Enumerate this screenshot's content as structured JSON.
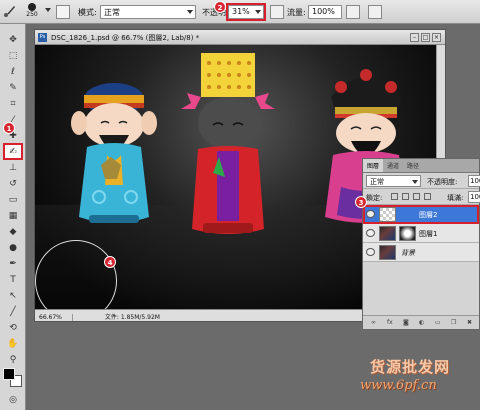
{
  "options_bar": {
    "brush_size": "250",
    "mode_label": "模式:",
    "mode_value": "正常",
    "opacity_label": "不透明度:",
    "opacity_value": "31%",
    "flow_label": "流量:",
    "flow_value": "100%"
  },
  "document": {
    "title": "DSC_1826_1.psd @ 66.7% (图層2, Lab/8) *",
    "zoom": "66.67%",
    "file_info": "文件: 1.85M/5.92M"
  },
  "badges": {
    "b1": "1",
    "b2": "2",
    "b3": "3",
    "b4": "4"
  },
  "layers_panel": {
    "tabs": [
      "图層",
      "通道",
      "路径"
    ],
    "blend_mode": "正常",
    "opacity_label": "不透明度:",
    "opacity_value": "100%",
    "lock_label": "鎖定:",
    "fill_label": "填滿:",
    "fill_value": "100%",
    "layers": [
      {
        "name": "图層2",
        "selected": true
      },
      {
        "name": "图層1",
        "selected": false
      },
      {
        "name": "背景",
        "selected": false
      }
    ],
    "footer_icons": [
      "link-icon",
      "fx-icon",
      "mask-icon",
      "adjustment-icon",
      "folder-icon",
      "new-layer-icon",
      "trash-icon"
    ]
  },
  "watermark": {
    "line1": "货源批发网",
    "line2": "www.6pf.cn"
  },
  "colors": {
    "highlight": "#d8202d",
    "selected_layer": "#3d78d8",
    "foreground": "#000000",
    "background": "#ffffff"
  }
}
